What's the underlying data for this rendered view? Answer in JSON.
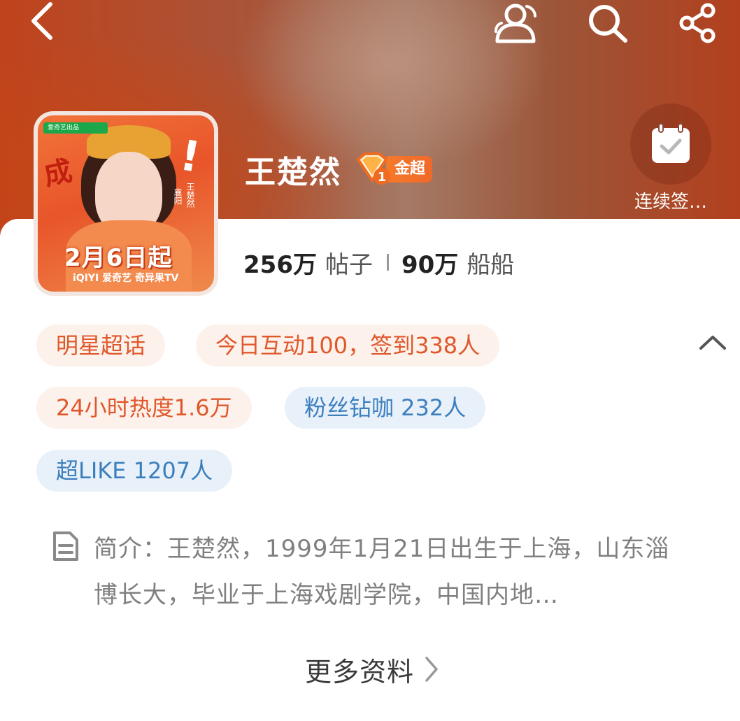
{
  "topic": {
    "name": "王楚然",
    "level_badge": "1",
    "badge_label": "金超"
  },
  "checkin": {
    "label": "连续签…"
  },
  "stats": {
    "posts_count": "256万",
    "posts_label": "帖子",
    "fans_count": "90万",
    "fans_label": "船船"
  },
  "poster": {
    "date": "2月6日起",
    "platforms": "iQIYI 爱奇艺  奇异果TV",
    "logo_1": "爱奇艺出品",
    "logo_2": "",
    "calligraphy": "成",
    "side_text_1": "王楚然",
    "side_text_2": "襄阳"
  },
  "chips": {
    "category": "明星超话",
    "today": "今日互动100，签到338人",
    "heat": "24小时热度1.6万",
    "diamond_fans": "粉丝钻咖 232人",
    "super_like": "超LIKE 1207人"
  },
  "intro": {
    "text": "简介：王楚然，1999年1月21日出生于上海，山东淄博长大，毕业于上海戏剧学院，中国内地…"
  },
  "more": {
    "label": "更多资料"
  },
  "icons": {
    "back": "back-arrow-icon",
    "fans": "fans-icon",
    "search": "search-icon",
    "share": "share-icon",
    "calendar": "calendar-check-icon",
    "collapse": "chevron-up-icon",
    "document": "document-icon",
    "chevron_right": "chevron-right-icon"
  },
  "colors": {
    "accent_orange": "#e0582a",
    "chip_warm_bg": "#fdf1ec",
    "chip_cool_text": "#3d7fbd",
    "chip_cool_bg": "#e8f1fa"
  }
}
